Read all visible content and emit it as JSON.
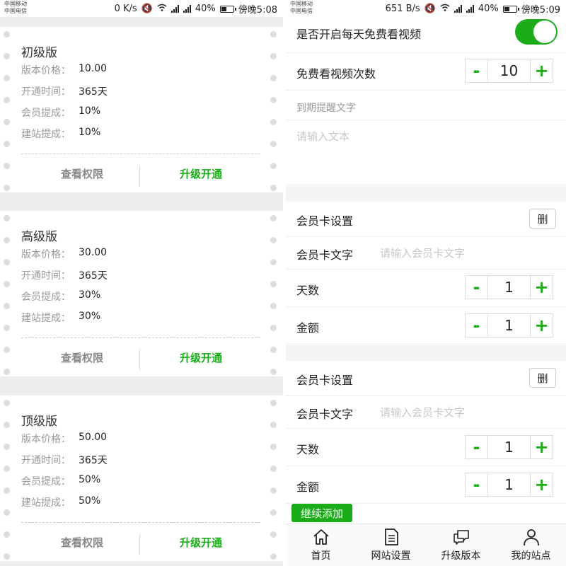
{
  "left": {
    "status": {
      "carrier1": "中国移动",
      "carrier2": "中国电信",
      "speed": "0 K/s",
      "battery": "40%",
      "time": "傍晚5:08"
    },
    "cards": [
      {
        "title": "初级版",
        "rows": [
          {
            "label": "版本价格：",
            "value": "10.00"
          },
          {
            "label": "开通时间：",
            "value": "365天"
          },
          {
            "label": "会员提成：",
            "value": "10%"
          },
          {
            "label": "建站提成：",
            "value": "10%"
          }
        ],
        "view": "查看权限",
        "upgrade": "升级开通"
      },
      {
        "title": "高级版",
        "rows": [
          {
            "label": "版本价格：",
            "value": "30.00"
          },
          {
            "label": "开通时间：",
            "value": "365天"
          },
          {
            "label": "会员提成：",
            "value": "30%"
          },
          {
            "label": "建站提成：",
            "value": "30%"
          }
        ],
        "view": "查看权限",
        "upgrade": "升级开通"
      },
      {
        "title": "顶级版",
        "rows": [
          {
            "label": "版本价格：",
            "value": "50.00"
          },
          {
            "label": "开通时间：",
            "value": "365天"
          },
          {
            "label": "会员提成：",
            "value": "50%"
          },
          {
            "label": "建站提成：",
            "value": "50%"
          }
        ],
        "view": "查看权限",
        "upgrade": "升级开通"
      }
    ]
  },
  "right": {
    "status": {
      "carrier1": "中国移动",
      "carrier2": "中国电信",
      "speed": "651 B/s",
      "battery": "40%",
      "time": "傍晚5:09"
    },
    "free_video_label": "是否开启每天免费看视频",
    "free_video_enabled": true,
    "free_count_label": "免费看视频次数",
    "free_count_value": "10",
    "expiry_label": "到期提醒文字",
    "expiry_placeholder": "请输入文本",
    "member_cards": [
      {
        "title": "会员卡设置",
        "delete": "删",
        "text_label": "会员卡文字",
        "text_placeholder": "请输入会员卡文字",
        "days_label": "天数",
        "days_value": "1",
        "amount_label": "金额",
        "amount_value": "1"
      },
      {
        "title": "会员卡设置",
        "delete": "删",
        "text_label": "会员卡文字",
        "text_placeholder": "请输入会员卡文字",
        "days_label": "天数",
        "days_value": "1",
        "amount_label": "金额",
        "amount_value": "1"
      }
    ],
    "minus": "-",
    "plus": "+",
    "add_more": "继续添加",
    "tabs": [
      {
        "label": "首页",
        "icon": "home-icon"
      },
      {
        "label": "网站设置",
        "icon": "document-icon"
      },
      {
        "label": "升级版本",
        "icon": "chat-icon"
      },
      {
        "label": "我的站点",
        "icon": "user-icon"
      }
    ],
    "accent": "#1aad19"
  }
}
